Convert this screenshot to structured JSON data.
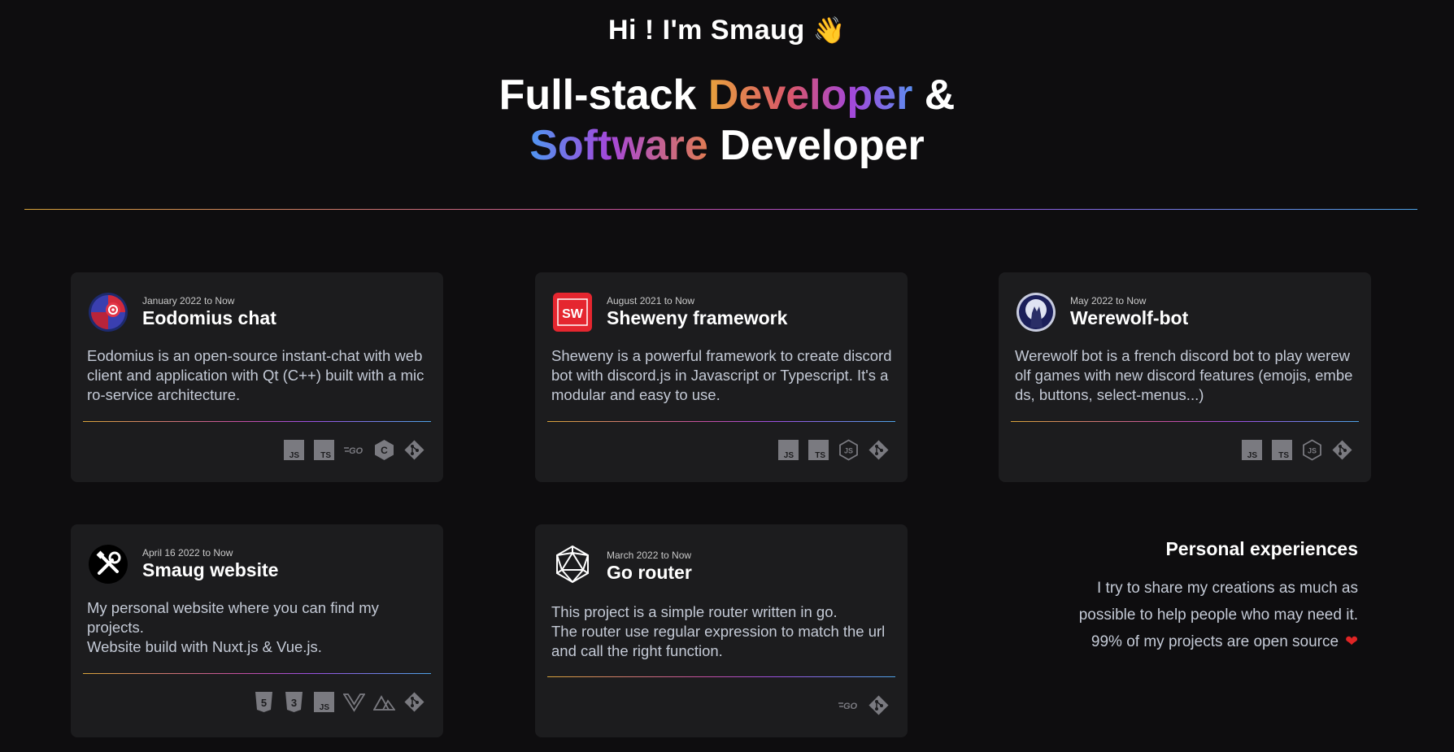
{
  "hero": {
    "greeting": "Hi ! I'm Smaug",
    "wave_icon": "waving-hand-icon",
    "title_part1": "Full-stack",
    "title_highlight1": "Developer",
    "title_part2": "&",
    "title_highlight2": "Software",
    "title_part3": "Developer"
  },
  "projects": [
    {
      "date": "January 2022 to Now",
      "name": "Eodomius chat",
      "description": "Eodomius is an open-source instant-chat with web client and application with Qt (C++) built with a micro-service architecture.",
      "tech_icons": [
        "javascript-icon",
        "typescript-icon",
        "go-icon",
        "cplusplus-icon",
        "git-icon"
      ]
    },
    {
      "date": "August 2021 to Now",
      "name": "Sheweny framework",
      "logo_text": "SW",
      "description": "Sheweny is a powerful framework to create discord bot with discord.js in Javascript or Typescript. It's a modular and easy to use.",
      "tech_icons": [
        "javascript-icon",
        "typescript-icon",
        "nodejs-icon",
        "git-icon"
      ]
    },
    {
      "date": "May 2022 to Now",
      "name": "Werewolf-bot",
      "description": "Werewolf bot is a french discord bot to play werewolf games with new discord features (emojis, embeds, buttons, select-menus...)",
      "tech_icons": [
        "javascript-icon",
        "typescript-icon",
        "nodejs-icon",
        "git-icon"
      ]
    },
    {
      "date": "April 16 2022 to Now",
      "name": "Smaug website",
      "description_line1": "My personal website where you can find my projects.",
      "description_line2": "Website build with Nuxt.js & Vue.js.",
      "tech_icons": [
        "html5-icon",
        "css3-icon",
        "javascript-icon",
        "vuejs-icon",
        "nuxtjs-icon",
        "git-icon"
      ]
    },
    {
      "date": "March 2022 to Now",
      "name": "Go router",
      "description_line1": "This project is a simple router written in go.",
      "description_line2": "The router use regular expression to match the url and call the right function.",
      "tech_icons": [
        "go-icon",
        "git-icon"
      ]
    }
  ],
  "personal": {
    "title": "Personal experiences",
    "line1": "I try to share my creations as much as",
    "line2": "possible to help people who may need it.",
    "line3": "99% of my projects are open source",
    "heart_icon": "heart-icon"
  },
  "colors": {
    "background": "#0e0d0f",
    "card": "#1c1c1e",
    "text_muted": "#c4cad6",
    "icon_gray": "#8a8a90",
    "accent_orange": "#e8a13c",
    "accent_purple": "#a447d9",
    "accent_blue": "#5c8df0",
    "heart": "#e02525"
  }
}
